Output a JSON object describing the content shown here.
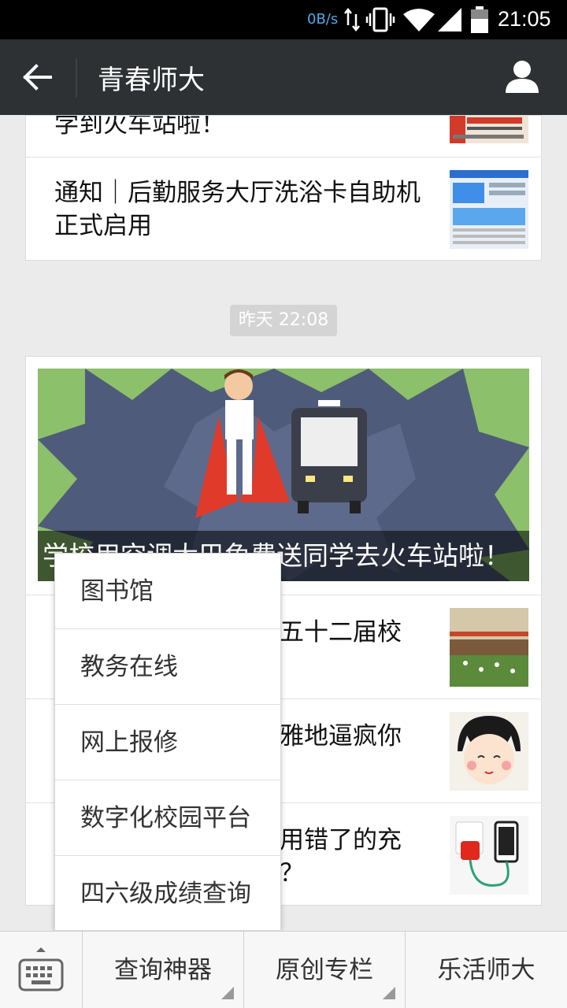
{
  "status_bar": {
    "net_speed": "0B/s",
    "time": "21:05"
  },
  "header": {
    "title": "青春师大"
  },
  "articles_top": [
    {
      "title": "学到火车站啦！"
    },
    {
      "title": "通知｜后勤服务大厅洗浴卡自助机正式启用"
    }
  ],
  "timestamp": "昨天 22:08",
  "hero": {
    "caption": "学校用空调大巴免费送同学去火车站啦！"
  },
  "articles": [
    {
      "title_visible": "五十二届校"
    },
    {
      "title_visible": "雅地逼疯你"
    },
    {
      "title_visible": "用错了的充",
      "title_visible_2": "？"
    }
  ],
  "popup_menu": {
    "items": [
      "图书馆",
      "教务在线",
      "网上报修",
      "数字化校园平台",
      "四六级成绩查询"
    ]
  },
  "bottom_menu": {
    "items": [
      "查询神器",
      "原创专栏",
      "乐活师大"
    ]
  }
}
